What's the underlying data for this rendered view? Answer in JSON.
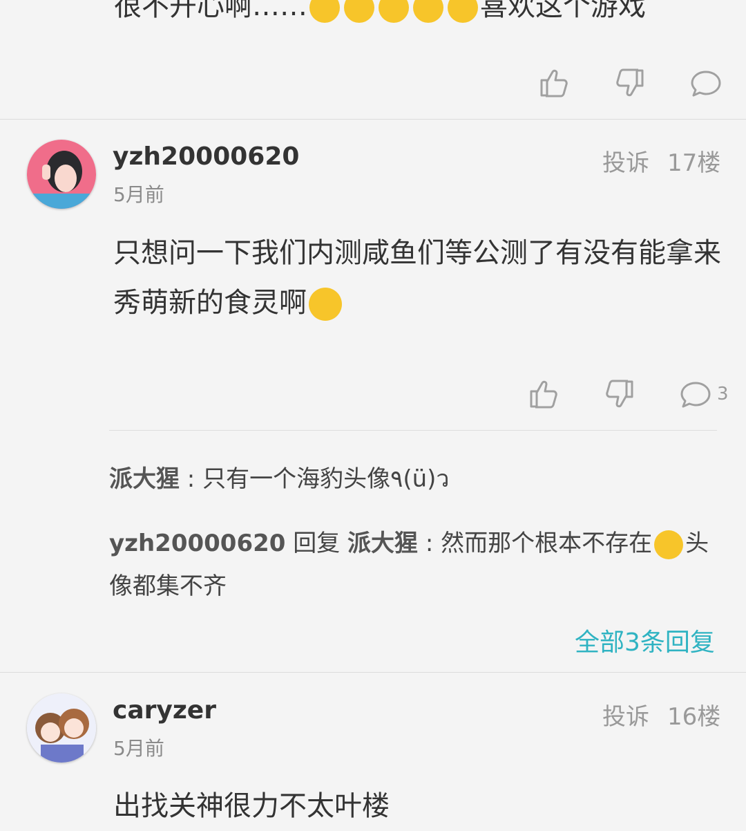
{
  "top_comment": {
    "partial_text_start": "很不开心啊……",
    "partial_text_end": "喜欢这个游戏"
  },
  "comments": [
    {
      "username": "yzh20000620",
      "time": "5月前",
      "report_label": "投诉",
      "floor": "17楼",
      "content": "只想问一下我们内测咸鱼们等公测了有没有能拿来秀萌新的食灵啊",
      "reply_count": "3",
      "replies": [
        {
          "author": "派大猩",
          "separator": " : ",
          "text": "只有一个海豹头像٩(ü)ว"
        },
        {
          "author": "yzh20000620",
          "reply_word": " 回复 ",
          "target": "派大猩",
          "separator": " : ",
          "text_before": "然而那个根本不存在",
          "text_after": "头像都集不齐"
        }
      ],
      "more_replies_label": "全部3条回复"
    },
    {
      "username": "caryzer",
      "time": "5月前",
      "report_label": "投诉",
      "floor": "16楼",
      "partial_content": "出找关神很力不太叶楼"
    }
  ],
  "colors": {
    "accent": "#2fb3c2",
    "background": "#f4f4f4",
    "icon_gray": "#a0a0a0"
  }
}
